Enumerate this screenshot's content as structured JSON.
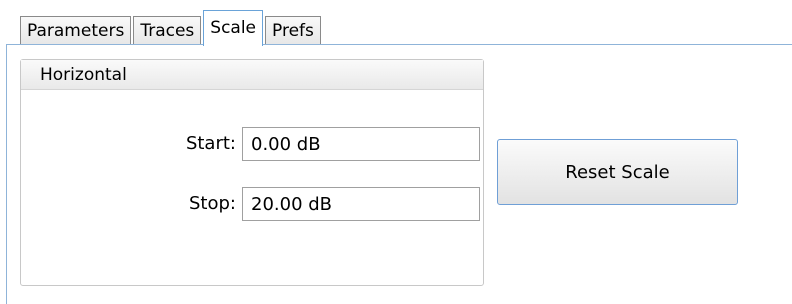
{
  "tabs": [
    {
      "label": "Parameters",
      "active": false
    },
    {
      "label": "Traces",
      "active": false
    },
    {
      "label": "Scale",
      "active": true
    },
    {
      "label": "Prefs",
      "active": false
    }
  ],
  "horizontal": {
    "title": "Horizontal",
    "start": {
      "label": "Start:",
      "value": "0.00 dB"
    },
    "stop": {
      "label": "Stop:",
      "value": "20.00 dB"
    }
  },
  "reset_button": {
    "label": "Reset Scale"
  },
  "colors": {
    "active_tab_border": "#6aa3d8",
    "panel_border": "#8fb4d9",
    "button_border": "#6f9fd6"
  }
}
